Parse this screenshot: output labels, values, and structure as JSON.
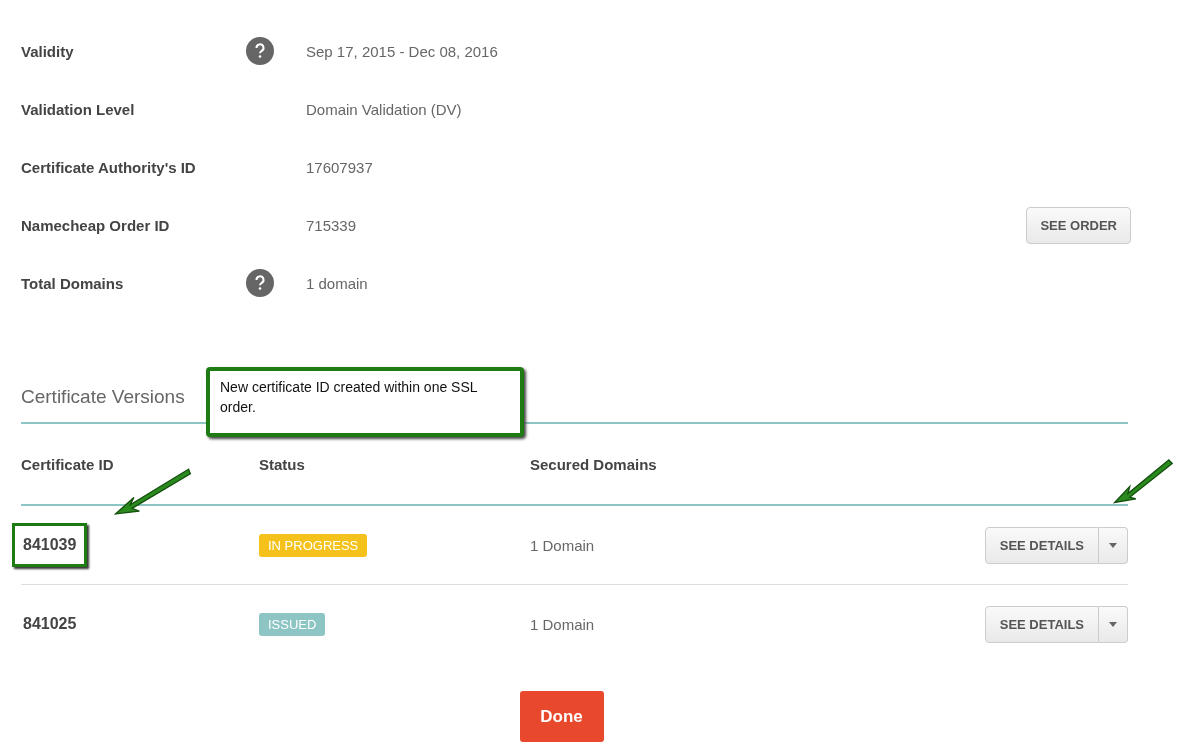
{
  "details": [
    {
      "label": "Validity",
      "help": true,
      "value": "Sep 17, 2015 - Dec 08, 2016"
    },
    {
      "label": "Validation Level",
      "help": false,
      "value": "Domain Validation (DV)"
    },
    {
      "label": "Certificate Authority's ID",
      "help": false,
      "value": "17607937"
    },
    {
      "label": "Namecheap Order ID",
      "help": false,
      "value": "715339",
      "button": "SEE ORDER"
    },
    {
      "label": "Total Domains",
      "help": true,
      "value": "1 domain"
    }
  ],
  "versions": {
    "title": "Certificate Versions",
    "columns": [
      "Certificate ID",
      "Status",
      "Secured Domains"
    ],
    "rows": [
      {
        "id": "841039",
        "status": "IN PROGRESS",
        "color": "#f5c21b",
        "domains": "1 Domain",
        "button": "SEE DETAILS",
        "highlighted": true
      },
      {
        "id": "841025",
        "status": "ISSUED",
        "color": "#8cc5c3",
        "domains": "1 Domain",
        "button": "SEE DETAILS",
        "highlighted": false
      }
    ]
  },
  "callout": "New certificate ID created within one SSL order.",
  "done_button": "Done"
}
